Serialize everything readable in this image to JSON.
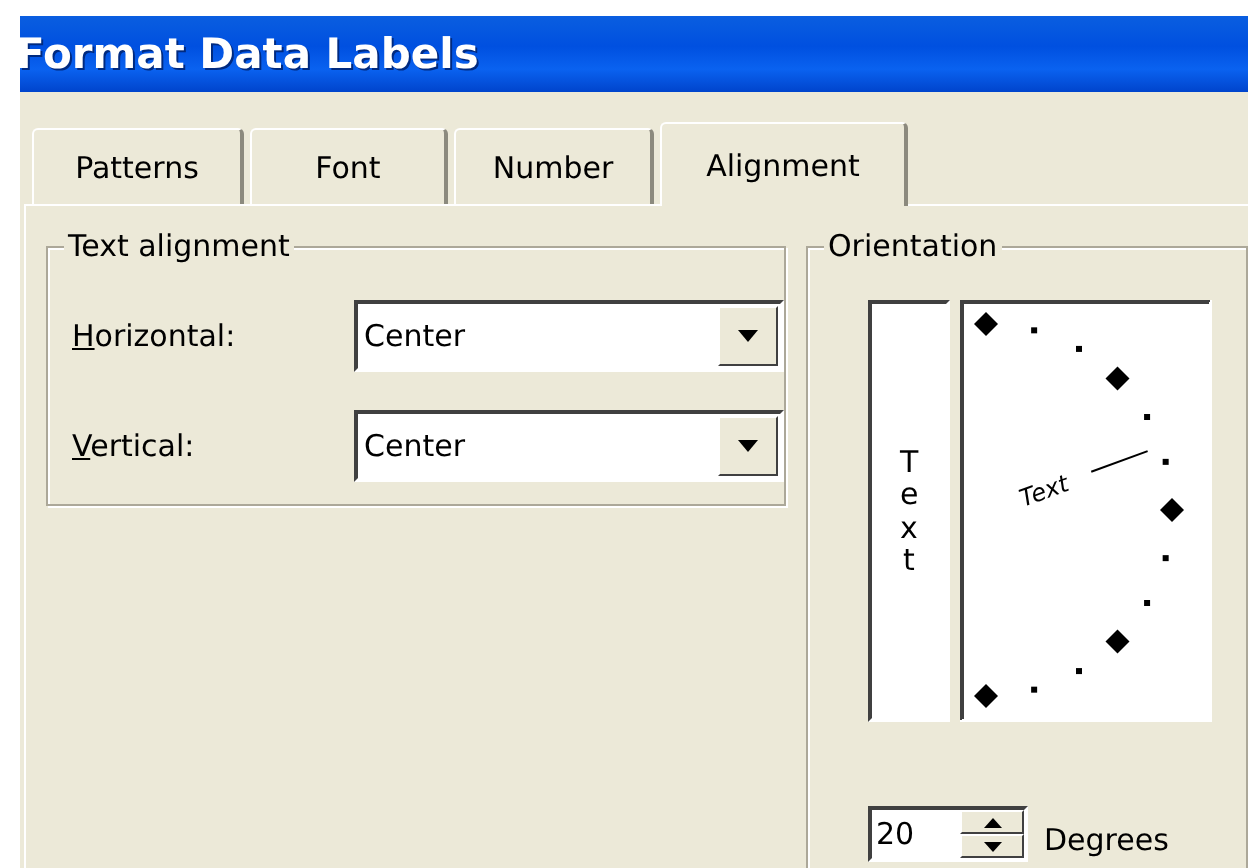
{
  "window": {
    "title": "Format Data Labels"
  },
  "tabs": [
    {
      "label": "Patterns",
      "selected": false
    },
    {
      "label": "Font",
      "selected": false
    },
    {
      "label": "Number",
      "selected": false
    },
    {
      "label": "Alignment",
      "selected": true
    }
  ],
  "text_alignment": {
    "title": "Text alignment",
    "fields": [
      {
        "label": "Horizontal:",
        "value": "Center"
      },
      {
        "label": "Vertical:",
        "value": "Center"
      }
    ]
  },
  "orientation": {
    "title": "Orientation",
    "vertical_text": "Text",
    "dial_text": "Text",
    "degrees": "20",
    "degrees_label": "Degrees"
  }
}
